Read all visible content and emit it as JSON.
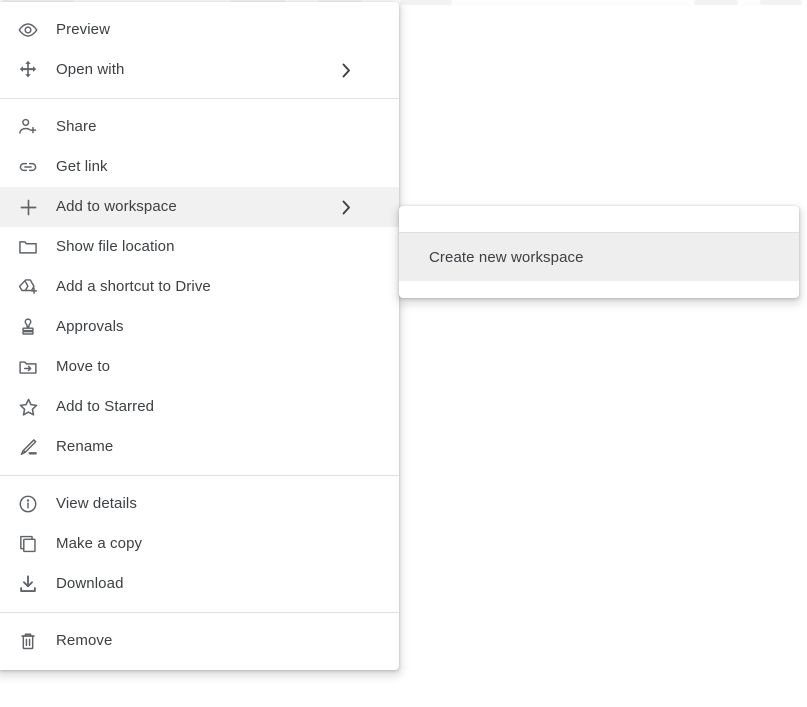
{
  "menu": {
    "name": "file-context-menu",
    "groups": [
      {
        "items": [
          {
            "label": "Preview",
            "icon": "eye-icon",
            "has_submenu": false
          },
          {
            "label": "Open with",
            "icon": "open-with-icon",
            "has_submenu": true
          }
        ]
      },
      {
        "items": [
          {
            "label": "Share",
            "icon": "person-add-icon",
            "has_submenu": false
          },
          {
            "label": "Get link",
            "icon": "link-icon",
            "has_submenu": false
          },
          {
            "label": "Add to workspace",
            "icon": "plus-icon",
            "has_submenu": true,
            "highlighted": true
          },
          {
            "label": "Show file location",
            "icon": "folder-icon",
            "has_submenu": false
          },
          {
            "label": "Add a shortcut to Drive",
            "icon": "drive-shortcut-icon",
            "has_submenu": false
          },
          {
            "label": "Approvals",
            "icon": "stamp-icon",
            "has_submenu": false
          },
          {
            "label": "Move to",
            "icon": "folder-move-icon",
            "has_submenu": false
          },
          {
            "label": "Add to Starred",
            "icon": "star-icon",
            "has_submenu": false
          },
          {
            "label": "Rename",
            "icon": "pencil-icon",
            "has_submenu": false
          }
        ]
      },
      {
        "items": [
          {
            "label": "View details",
            "icon": "info-icon",
            "has_submenu": false
          },
          {
            "label": "Make a copy",
            "icon": "copy-icon",
            "has_submenu": false
          },
          {
            "label": "Download",
            "icon": "download-icon",
            "has_submenu": false
          }
        ]
      },
      {
        "items": [
          {
            "label": "Remove",
            "icon": "trash-icon",
            "has_submenu": false
          }
        ]
      }
    ]
  },
  "submenu": {
    "name": "add-to-workspace-submenu",
    "items": [
      {
        "label": "Create new workspace",
        "highlighted": true
      }
    ]
  },
  "colors": {
    "menu_background": "#ffffff",
    "highlight": "#f1f1f1",
    "submenu_highlight": "#eeeeee",
    "text": "#3c4043",
    "icon": "#5f6368",
    "divider": "#e0e0e0"
  }
}
